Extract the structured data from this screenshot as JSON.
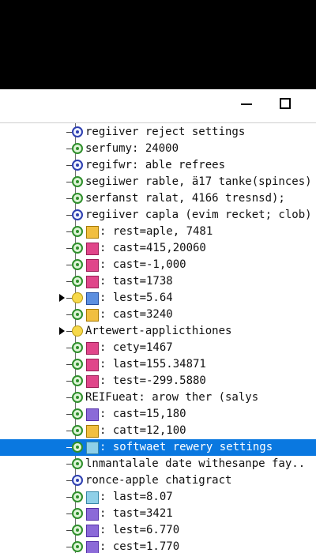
{
  "window": {
    "minimize_icon": "minimize-icon",
    "maximize_icon": "maximize-icon"
  },
  "tree": {
    "rows": [
      {
        "label": "regiiver reject settings",
        "icon": "gear-icon",
        "type": null,
        "selected": false,
        "expand": false
      },
      {
        "label": "serfumy: 24000",
        "icon": "leaf-icon",
        "type": null,
        "selected": false,
        "expand": false
      },
      {
        "label": "regifwr: able refrees",
        "icon": "gear-icon",
        "type": null,
        "selected": false,
        "expand": false
      },
      {
        "label": "segiiwer rable, ä17 tanke(spinces)",
        "icon": "leaf-icon",
        "type": null,
        "selected": false,
        "expand": false
      },
      {
        "label": "serfanst ralat, 4166 tresnsd);",
        "icon": "leaf-icon",
        "type": null,
        "selected": false,
        "expand": false
      },
      {
        "label": "regiiver capla (evim recket; clob)",
        "icon": "gear-icon",
        "type": null,
        "selected": false,
        "expand": false
      },
      {
        "label": ": rest=aple, 7481",
        "icon": "leaf-icon",
        "type": "yellow",
        "selected": false,
        "expand": false
      },
      {
        "label": ": cast=415,20060",
        "icon": "leaf-icon",
        "type": "red",
        "selected": false,
        "expand": false
      },
      {
        "label": ": cast=-1,000",
        "icon": "leaf-icon",
        "type": "red",
        "selected": false,
        "expand": false
      },
      {
        "label": ": tast=1738",
        "icon": "leaf-icon",
        "type": "red",
        "selected": false,
        "expand": false
      },
      {
        "label": ": lest=5.64",
        "icon": "folder-icon",
        "type": "blue",
        "selected": false,
        "expand": true
      },
      {
        "label": ": cast=3240",
        "icon": "leaf-icon",
        "type": "yellow",
        "selected": false,
        "expand": false
      },
      {
        "label": "Artewert-applicthiones",
        "icon": "folder-icon",
        "type": null,
        "selected": false,
        "expand": true
      },
      {
        "label": ": cety=1467",
        "icon": "leaf-icon",
        "type": "red",
        "selected": false,
        "expand": false
      },
      {
        "label": ": last=155.34871",
        "icon": "leaf-icon",
        "type": "red",
        "selected": false,
        "expand": false
      },
      {
        "label": ": test=-299.5880",
        "icon": "leaf-icon",
        "type": "red",
        "selected": false,
        "expand": false
      },
      {
        "label": "REIFueat: arow ther (salys",
        "icon": "leaf-icon",
        "type": null,
        "selected": false,
        "expand": false
      },
      {
        "label": ": cast=15,180",
        "icon": "leaf-icon",
        "type": "purple",
        "selected": false,
        "expand": false
      },
      {
        "label": ": catt=12,100",
        "icon": "leaf-icon",
        "type": "yellow",
        "selected": false,
        "expand": false
      },
      {
        "label": ": softwaet rewery settings",
        "icon": "leaf-icon",
        "type": "cyan",
        "selected": true,
        "expand": false
      },
      {
        "label": "lnmantalale date withesanpe fay..",
        "icon": "leaf-icon",
        "type": null,
        "selected": false,
        "expand": false
      },
      {
        "label": "ronce-apple chatigract",
        "icon": "gear-icon",
        "type": null,
        "selected": false,
        "expand": false
      },
      {
        "label": ": last=8.07",
        "icon": "leaf-icon",
        "type": "cyan",
        "selected": false,
        "expand": false
      },
      {
        "label": ": tast=3421",
        "icon": "leaf-icon",
        "type": "purple",
        "selected": false,
        "expand": false
      },
      {
        "label": ": lest=6.770",
        "icon": "leaf-icon",
        "type": "purple",
        "selected": false,
        "expand": false
      },
      {
        "label": ": cest=1.770",
        "icon": "leaf-icon",
        "type": "purple",
        "selected": false,
        "expand": false
      }
    ]
  }
}
